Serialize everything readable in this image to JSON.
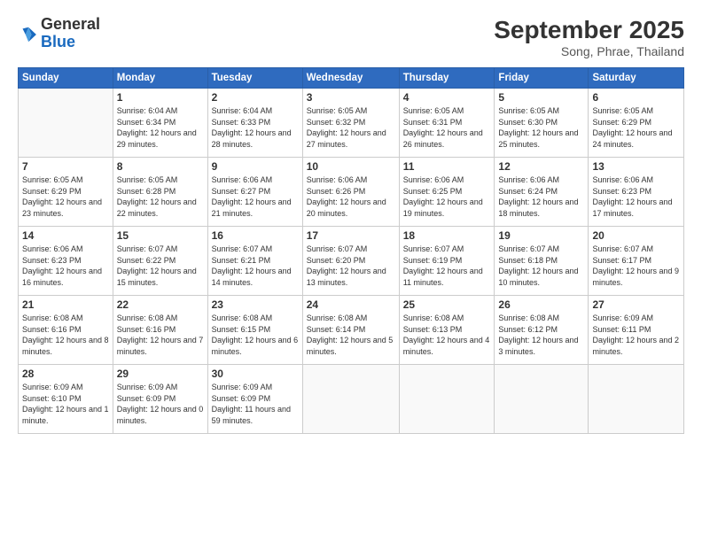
{
  "header": {
    "logo": {
      "general": "General",
      "blue": "Blue"
    },
    "title": "September 2025",
    "location": "Song, Phrae, Thailand"
  },
  "weekdays": [
    "Sunday",
    "Monday",
    "Tuesday",
    "Wednesday",
    "Thursday",
    "Friday",
    "Saturday"
  ],
  "weeks": [
    [
      {
        "day": null
      },
      {
        "day": "1",
        "sunrise": "6:04 AM",
        "sunset": "6:34 PM",
        "daylight": "12 hours and 29 minutes."
      },
      {
        "day": "2",
        "sunrise": "6:04 AM",
        "sunset": "6:33 PM",
        "daylight": "12 hours and 28 minutes."
      },
      {
        "day": "3",
        "sunrise": "6:05 AM",
        "sunset": "6:32 PM",
        "daylight": "12 hours and 27 minutes."
      },
      {
        "day": "4",
        "sunrise": "6:05 AM",
        "sunset": "6:31 PM",
        "daylight": "12 hours and 26 minutes."
      },
      {
        "day": "5",
        "sunrise": "6:05 AM",
        "sunset": "6:30 PM",
        "daylight": "12 hours and 25 minutes."
      },
      {
        "day": "6",
        "sunrise": "6:05 AM",
        "sunset": "6:29 PM",
        "daylight": "12 hours and 24 minutes."
      }
    ],
    [
      {
        "day": "7",
        "sunrise": "6:05 AM",
        "sunset": "6:29 PM",
        "daylight": "12 hours and 23 minutes."
      },
      {
        "day": "8",
        "sunrise": "6:05 AM",
        "sunset": "6:28 PM",
        "daylight": "12 hours and 22 minutes."
      },
      {
        "day": "9",
        "sunrise": "6:06 AM",
        "sunset": "6:27 PM",
        "daylight": "12 hours and 21 minutes."
      },
      {
        "day": "10",
        "sunrise": "6:06 AM",
        "sunset": "6:26 PM",
        "daylight": "12 hours and 20 minutes."
      },
      {
        "day": "11",
        "sunrise": "6:06 AM",
        "sunset": "6:25 PM",
        "daylight": "12 hours and 19 minutes."
      },
      {
        "day": "12",
        "sunrise": "6:06 AM",
        "sunset": "6:24 PM",
        "daylight": "12 hours and 18 minutes."
      },
      {
        "day": "13",
        "sunrise": "6:06 AM",
        "sunset": "6:23 PM",
        "daylight": "12 hours and 17 minutes."
      }
    ],
    [
      {
        "day": "14",
        "sunrise": "6:06 AM",
        "sunset": "6:23 PM",
        "daylight": "12 hours and 16 minutes."
      },
      {
        "day": "15",
        "sunrise": "6:07 AM",
        "sunset": "6:22 PM",
        "daylight": "12 hours and 15 minutes."
      },
      {
        "day": "16",
        "sunrise": "6:07 AM",
        "sunset": "6:21 PM",
        "daylight": "12 hours and 14 minutes."
      },
      {
        "day": "17",
        "sunrise": "6:07 AM",
        "sunset": "6:20 PM",
        "daylight": "12 hours and 13 minutes."
      },
      {
        "day": "18",
        "sunrise": "6:07 AM",
        "sunset": "6:19 PM",
        "daylight": "12 hours and 11 minutes."
      },
      {
        "day": "19",
        "sunrise": "6:07 AM",
        "sunset": "6:18 PM",
        "daylight": "12 hours and 10 minutes."
      },
      {
        "day": "20",
        "sunrise": "6:07 AM",
        "sunset": "6:17 PM",
        "daylight": "12 hours and 9 minutes."
      }
    ],
    [
      {
        "day": "21",
        "sunrise": "6:08 AM",
        "sunset": "6:16 PM",
        "daylight": "12 hours and 8 minutes."
      },
      {
        "day": "22",
        "sunrise": "6:08 AM",
        "sunset": "6:16 PM",
        "daylight": "12 hours and 7 minutes."
      },
      {
        "day": "23",
        "sunrise": "6:08 AM",
        "sunset": "6:15 PM",
        "daylight": "12 hours and 6 minutes."
      },
      {
        "day": "24",
        "sunrise": "6:08 AM",
        "sunset": "6:14 PM",
        "daylight": "12 hours and 5 minutes."
      },
      {
        "day": "25",
        "sunrise": "6:08 AM",
        "sunset": "6:13 PM",
        "daylight": "12 hours and 4 minutes."
      },
      {
        "day": "26",
        "sunrise": "6:08 AM",
        "sunset": "6:12 PM",
        "daylight": "12 hours and 3 minutes."
      },
      {
        "day": "27",
        "sunrise": "6:09 AM",
        "sunset": "6:11 PM",
        "daylight": "12 hours and 2 minutes."
      }
    ],
    [
      {
        "day": "28",
        "sunrise": "6:09 AM",
        "sunset": "6:10 PM",
        "daylight": "12 hours and 1 minute."
      },
      {
        "day": "29",
        "sunrise": "6:09 AM",
        "sunset": "6:09 PM",
        "daylight": "12 hours and 0 minutes."
      },
      {
        "day": "30",
        "sunrise": "6:09 AM",
        "sunset": "6:09 PM",
        "daylight": "11 hours and 59 minutes."
      },
      {
        "day": null
      },
      {
        "day": null
      },
      {
        "day": null
      },
      {
        "day": null
      }
    ]
  ]
}
